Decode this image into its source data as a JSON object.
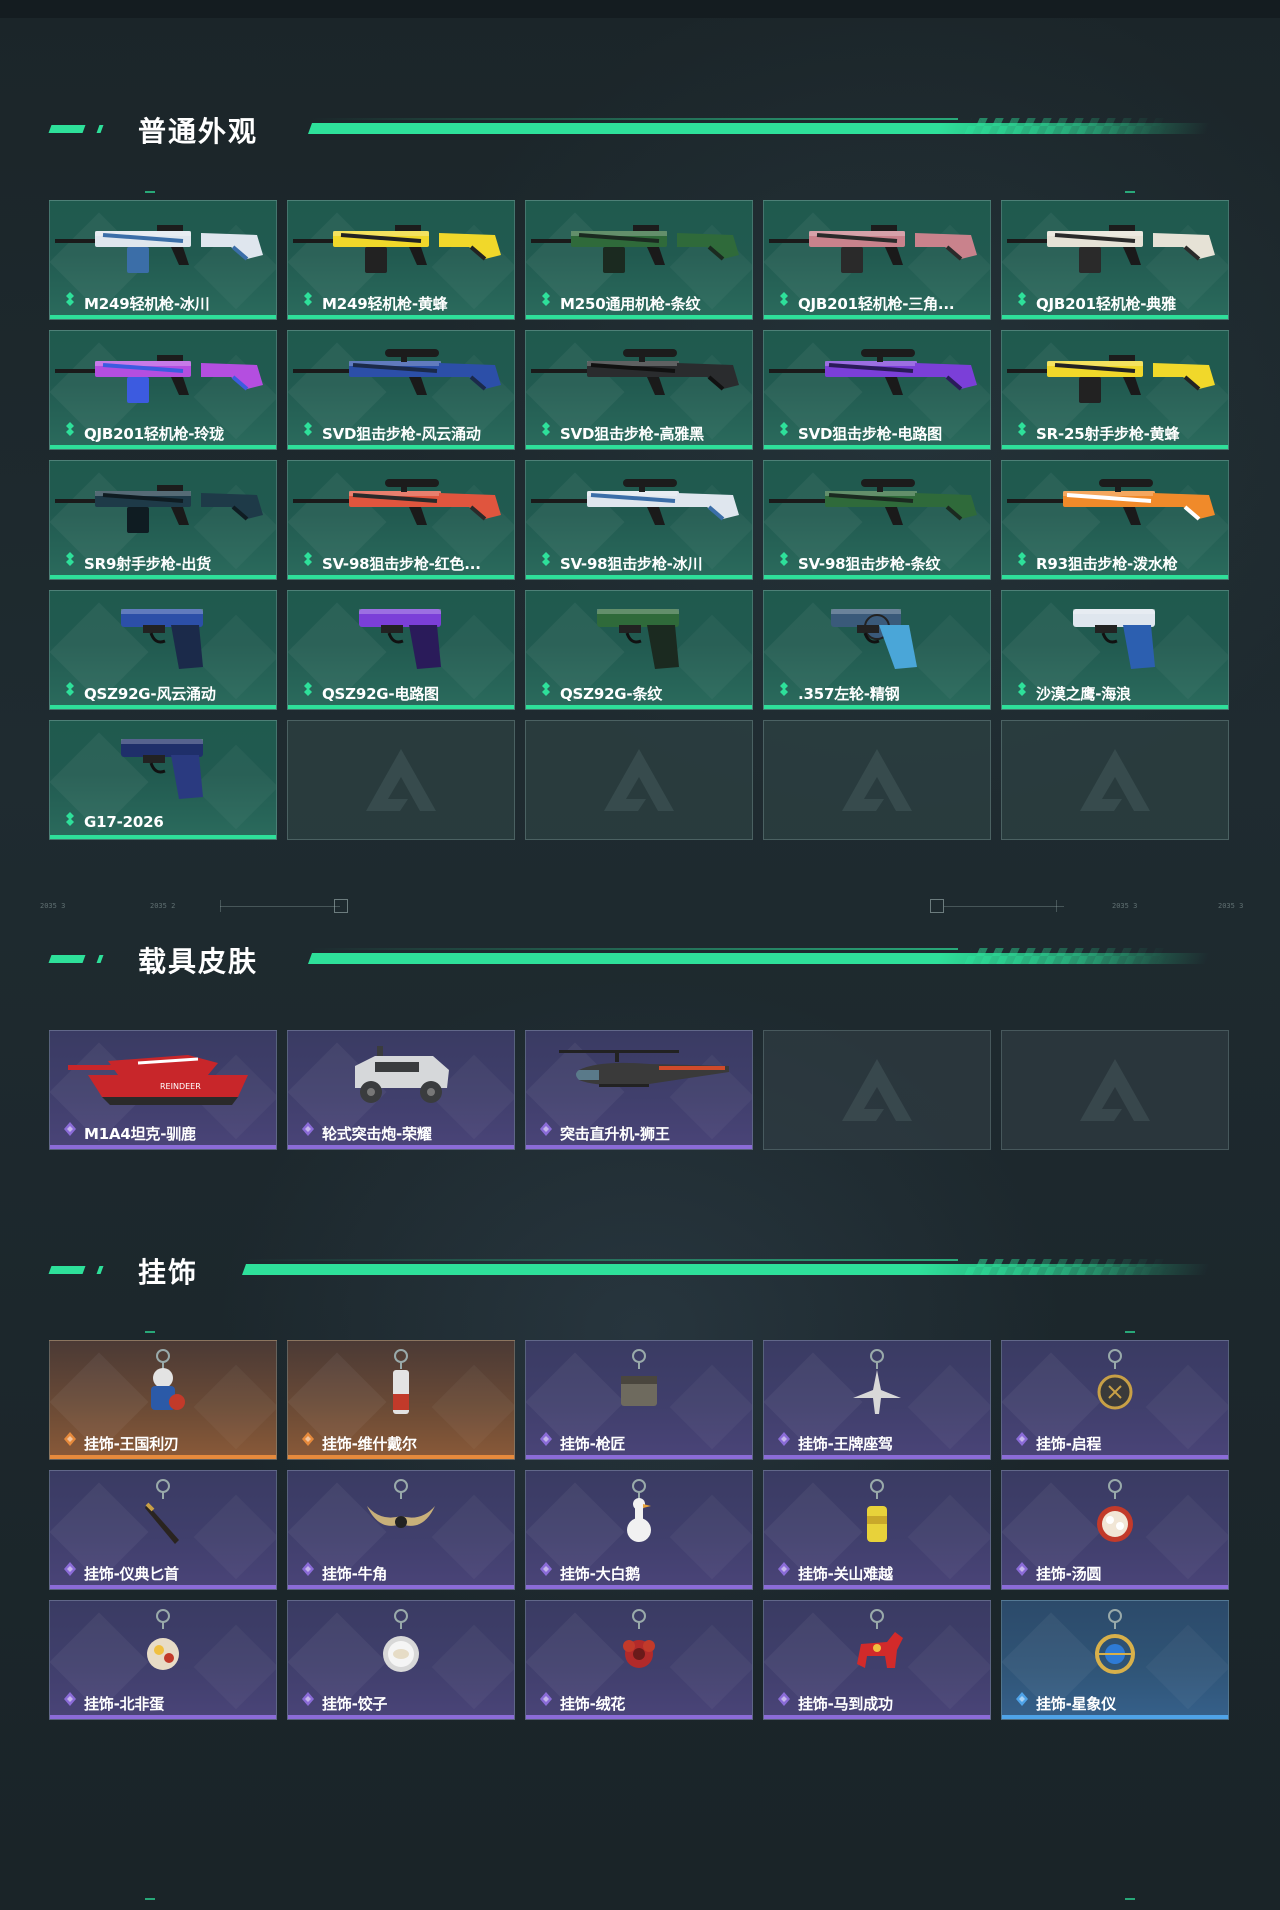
{
  "sections": [
    {
      "title": "普通外观"
    },
    {
      "title": "载具皮肤"
    },
    {
      "title": "挂饰"
    }
  ],
  "weapons": [
    {
      "name": "M249轻机枪-冰川",
      "icon": "lmg-icon",
      "colors": [
        "#dfe6ee",
        "#3b6ea8"
      ]
    },
    {
      "name": "M249轻机枪-黄蜂",
      "icon": "lmg-icon",
      "colors": [
        "#f1d82a",
        "#222222"
      ]
    },
    {
      "name": "M250通用机枪-条纹",
      "icon": "lmg-icon",
      "colors": [
        "#2f6a3a",
        "#1b2a20"
      ]
    },
    {
      "name": "QJB201轻机枪-三角...",
      "icon": "lmg-icon",
      "colors": [
        "#c9828c",
        "#2a2a2a"
      ]
    },
    {
      "name": "QJB201轻机枪-典雅",
      "icon": "lmg-icon",
      "colors": [
        "#e6e2d6",
        "#2a2a2a"
      ]
    },
    {
      "name": "QJB201轻机枪-玲珑",
      "icon": "lmg-icon",
      "colors": [
        "#b44ee0",
        "#3c5be0"
      ]
    },
    {
      "name": "SVD狙击步枪-风云涌动",
      "icon": "sniper-rifle-icon",
      "colors": [
        "#2c4fa8",
        "#1b2a4a"
      ]
    },
    {
      "name": "SVD狙击步枪-高雅黑",
      "icon": "sniper-rifle-icon",
      "colors": [
        "#2a2c2e",
        "#111111"
      ]
    },
    {
      "name": "SVD狙击步枪-电路图",
      "icon": "sniper-rifle-icon",
      "colors": [
        "#7b3fd8",
        "#2a1b5a"
      ]
    },
    {
      "name": "SR-25射手步枪-黄蜂",
      "icon": "rifle-icon",
      "colors": [
        "#f1d82a",
        "#222222"
      ]
    },
    {
      "name": "SR9射手步枪-出货",
      "icon": "rifle-icon",
      "colors": [
        "#1e3a48",
        "#0f1c22"
      ]
    },
    {
      "name": "SV-98狙击步枪-红色...",
      "icon": "sniper-rifle-icon",
      "colors": [
        "#e0553e",
        "#2a2a2a"
      ]
    },
    {
      "name": "SV-98狙击步枪-冰川",
      "icon": "sniper-rifle-icon",
      "colors": [
        "#dfe6ee",
        "#3b6ea8"
      ]
    },
    {
      "name": "SV-98狙击步枪-条纹",
      "icon": "sniper-rifle-icon",
      "colors": [
        "#2f6a3a",
        "#1b2a20"
      ]
    },
    {
      "name": "R93狙击步枪-泼水枪",
      "icon": "sniper-rifle-icon",
      "colors": [
        "#f08a2a",
        "#ffffff"
      ]
    },
    {
      "name": "QSZ92G-风云涌动",
      "icon": "pistol-icon",
      "colors": [
        "#2c4fa8",
        "#1b2a4a"
      ]
    },
    {
      "name": "QSZ92G-电路图",
      "icon": "pistol-icon",
      "colors": [
        "#7b3fd8",
        "#2a1b5a"
      ]
    },
    {
      "name": "QSZ92G-条纹",
      "icon": "pistol-icon",
      "colors": [
        "#2f6a3a",
        "#1b2a20"
      ]
    },
    {
      "name": ".357左轮-精钢",
      "icon": "revolver-icon",
      "colors": [
        "#3a5a7a",
        "#4aa6d8"
      ]
    },
    {
      "name": "沙漠之鹰-海浪",
      "icon": "pistol-icon",
      "colors": [
        "#dfe6ee",
        "#2c5fb0"
      ]
    },
    {
      "name": "G17-2026",
      "icon": "pistol-icon",
      "colors": [
        "#1f2f6a",
        "#2a3a80"
      ]
    }
  ],
  "vehicles": [
    {
      "name": "M1A4坦克-驯鹿",
      "icon": "tank-icon",
      "colors": [
        "#c8262a",
        "#ffffff"
      ]
    },
    {
      "name": "轮式突击炮-荣耀",
      "icon": "armored-car-icon",
      "colors": [
        "#d6d8da",
        "#3a3c3e"
      ]
    },
    {
      "name": "突击直升机-狮王",
      "icon": "helicopter-icon",
      "colors": [
        "#3a3a3a",
        "#d04a2a"
      ]
    }
  ],
  "charms": [
    {
      "name": "挂饰-王国利刃",
      "icon": "knight-figure-icon",
      "rarity": "orange"
    },
    {
      "name": "挂饰-维什戴尔",
      "icon": "figure-charm-icon",
      "rarity": "orange"
    },
    {
      "name": "挂饰-枪匠",
      "icon": "toolbox-charm-icon",
      "rarity": "purple"
    },
    {
      "name": "挂饰-王牌座驾",
      "icon": "jet-charm-icon",
      "rarity": "purple"
    },
    {
      "name": "挂饰-启程",
      "icon": "medal-charm-icon",
      "rarity": "purple"
    },
    {
      "name": "挂饰-仪典匕首",
      "icon": "dagger-charm-icon",
      "rarity": "purple"
    },
    {
      "name": "挂饰-牛角",
      "icon": "horns-charm-icon",
      "rarity": "purple"
    },
    {
      "name": "挂饰-大白鹅",
      "icon": "goose-charm-icon",
      "rarity": "purple"
    },
    {
      "name": "挂饰-关山难越",
      "icon": "can-charm-icon",
      "rarity": "purple"
    },
    {
      "name": "挂饰-汤圆",
      "icon": "bowl-charm-icon",
      "rarity": "purple"
    },
    {
      "name": "挂饰-北非蛋",
      "icon": "plate-charm-icon",
      "rarity": "purple"
    },
    {
      "name": "挂饰-饺子",
      "icon": "dumpling-charm-icon",
      "rarity": "purple"
    },
    {
      "name": "挂饰-绒花",
      "icon": "flower-charm-icon",
      "rarity": "purple"
    },
    {
      "name": "挂饰-马到成功",
      "icon": "horse-charm-icon",
      "rarity": "purple"
    },
    {
      "name": "挂饰-星象仪",
      "icon": "astrolabe-charm-icon",
      "rarity": "blue"
    }
  ],
  "theme": {
    "accent": "#2ee09a",
    "purple": "#8b6cd8",
    "orange": "#e68a3c",
    "blue": "#4fa3e8"
  }
}
